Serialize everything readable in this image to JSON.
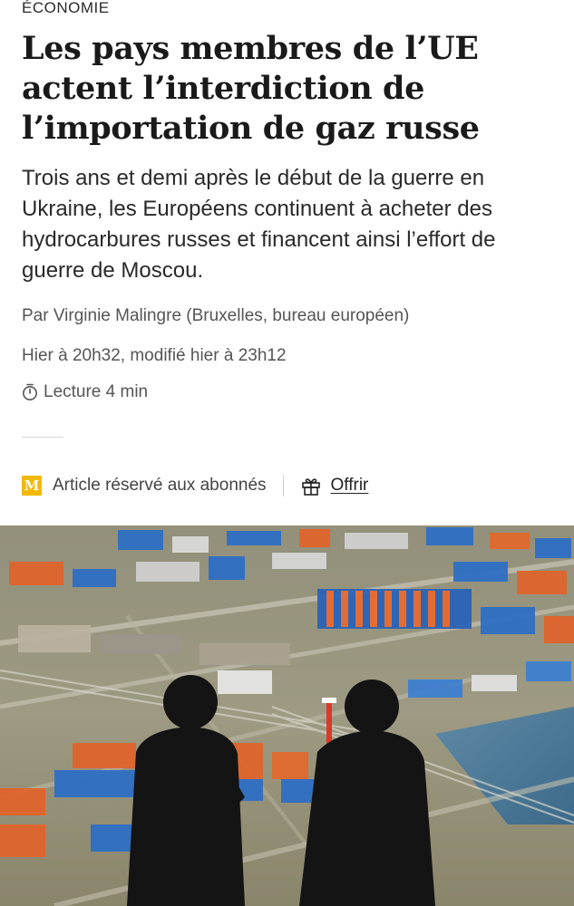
{
  "article": {
    "section": "ÉCONOMIE",
    "title": "Les pays membres de l’UE actent l’interdiction de l’importation de gaz russe",
    "subtitle": "Trois ans et demi après le début de la guerre en Ukraine, les Européens continuent à acheter des hydrocarbures russes et financent ainsi l’effort de guerre de Moscou.",
    "byline": "Par Virginie Malingre (Bruxelles, bureau européen)",
    "dates": "Hier à 20h32, modifié hier à 23h12",
    "reading_time": "Lecture 4 min"
  },
  "subscriber": {
    "badge_letter": "M",
    "label": "Article réservé aux abonnés",
    "offer_label": "Offrir",
    "badge_color": "#f2b900"
  },
  "icons": {
    "reading": "timer-icon",
    "offer": "gift-icon"
  }
}
